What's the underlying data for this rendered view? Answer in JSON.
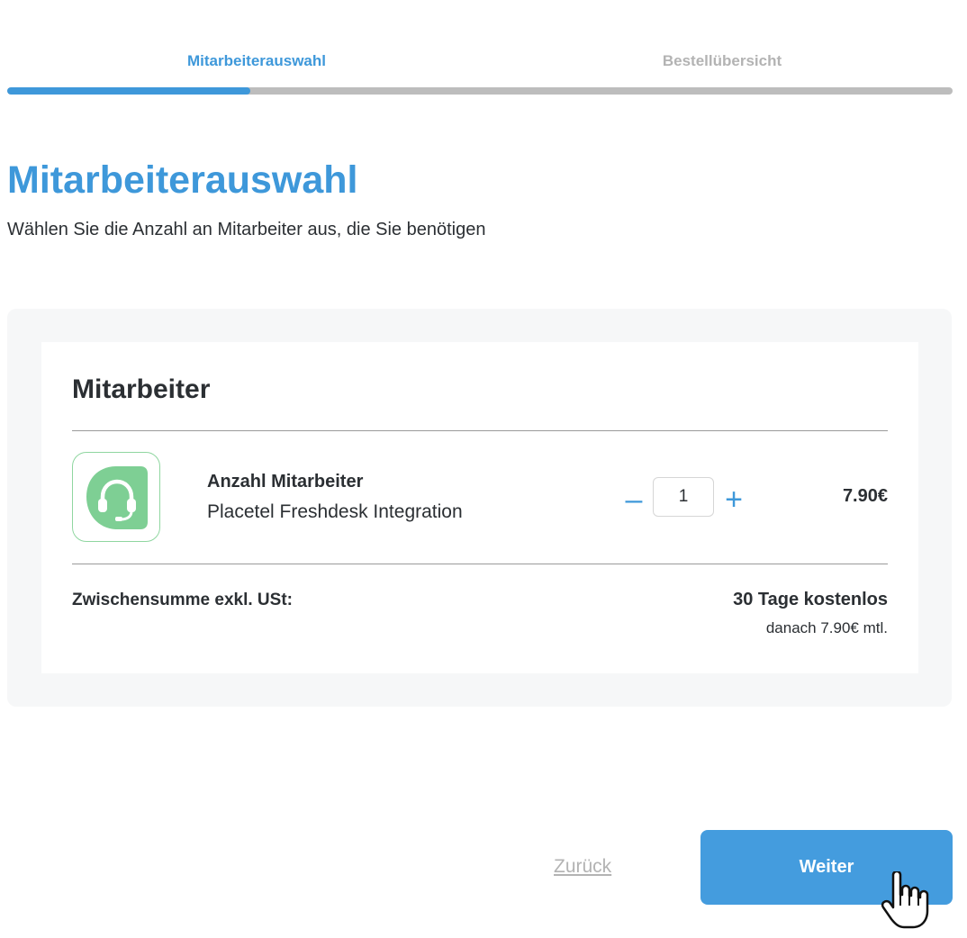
{
  "steps": {
    "items": [
      {
        "label": "Mitarbeiterauswahl",
        "active": true
      },
      {
        "label": "Bestellübersicht",
        "active": false
      }
    ],
    "progress_fraction": 0.257
  },
  "header": {
    "title": "Mitarbeiterauswahl",
    "subtitle": "Wählen Sie die Anzahl an Mitarbeiter aus, die Sie benötigen"
  },
  "card": {
    "title": "Mitarbeiter",
    "product": {
      "icon": "headset-icon",
      "name": "Anzahl Mitarbeiter",
      "description": "Placetel Freshdesk Integration",
      "quantity": "1",
      "minus_label": "–",
      "plus_label": "+",
      "price": "7.90€"
    },
    "subtotal": {
      "label": "Zwischensumme exkl. USt:",
      "value": "30 Tage kostenlos",
      "note": "danach 7.90€ mtl."
    }
  },
  "footer": {
    "back_label": "Zurück",
    "next_label": "Weiter"
  },
  "colors": {
    "accent": "#3e98da",
    "button": "#449cde",
    "icon_green": "#7ecf94",
    "inactive": "#b3b3b3"
  }
}
